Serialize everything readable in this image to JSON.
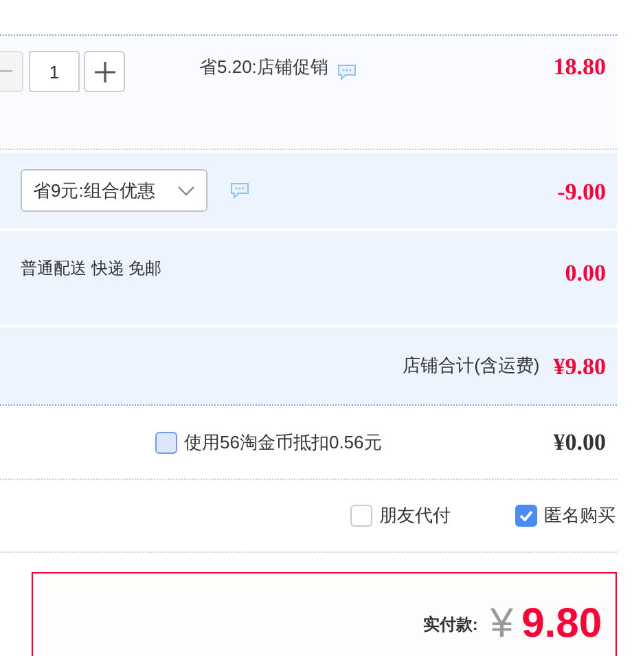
{
  "item": {
    "quantity": "1",
    "promo": "省5.20:店铺促销",
    "price": "18.80"
  },
  "discount": {
    "selection": "省9元:组合优惠",
    "amount": "-9.00"
  },
  "shipping": {
    "label": "普通配送 快递 免邮",
    "amount": "0.00"
  },
  "shop_total": {
    "label": "店铺合计(含运费)",
    "amount": "¥9.80"
  },
  "coins": {
    "label": "使用56淘金币抵扣0.56元",
    "checked": false,
    "highlighted": true,
    "amount": "¥0.00"
  },
  "options": [
    {
      "label": "朋友代付",
      "checked": false
    },
    {
      "label": "匿名购买",
      "checked": true
    }
  ],
  "payment": {
    "label": "实付款:",
    "currency": "¥",
    "amount": "9.80"
  }
}
